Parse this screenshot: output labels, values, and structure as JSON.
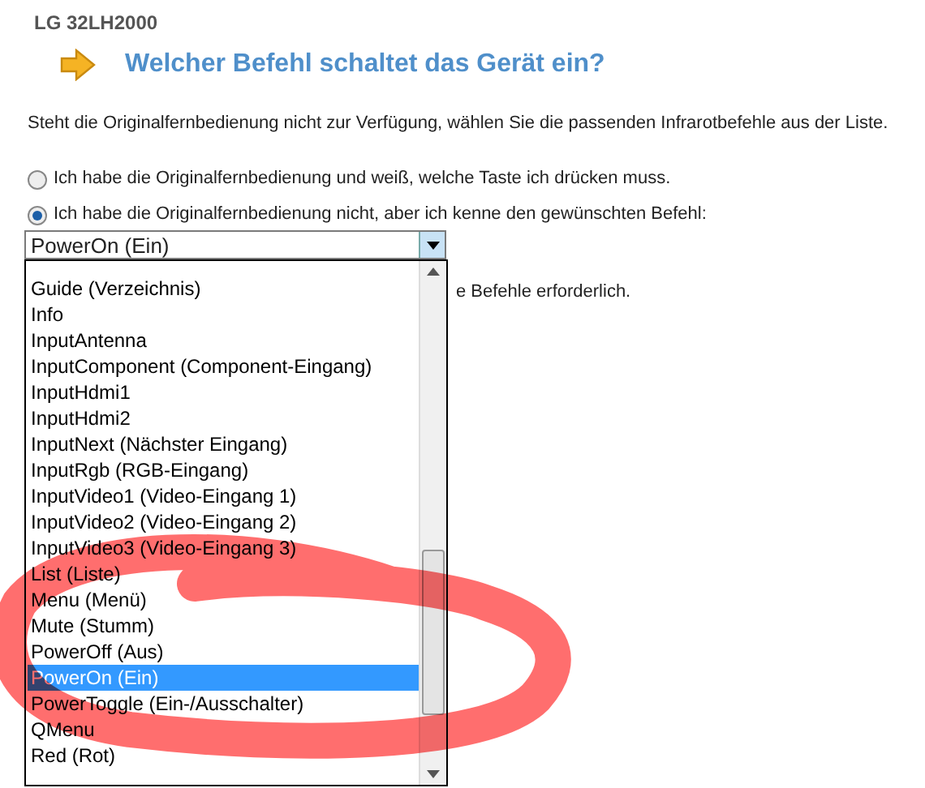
{
  "device_label": "LG 32LH2000",
  "heading": "Welcher Befehl schaltet das Gerät ein?",
  "instruction": "Steht die Originalfernbedienung nicht zur Verfügung, wählen Sie die passenden Infrarotbefehle aus der Liste.",
  "radios": [
    {
      "label": "Ich habe die Originalfernbedienung und weiß, welche Taste ich drücken muss.",
      "selected": false
    },
    {
      "label": "Ich habe die Originalfernbedienung nicht, aber ich kenne den gewünschten Befehl:",
      "selected": true
    }
  ],
  "select": {
    "value": "PowerOn (Ein)"
  },
  "note_behind_list": "e Befehle erforderlich.",
  "dropdown": {
    "items": [
      {
        "label": "Guide (Verzeichnis)",
        "selected": false
      },
      {
        "label": "Info",
        "selected": false
      },
      {
        "label": "InputAntenna",
        "selected": false
      },
      {
        "label": "InputComponent (Component-Eingang)",
        "selected": false
      },
      {
        "label": "InputHdmi1",
        "selected": false
      },
      {
        "label": "InputHdmi2",
        "selected": false
      },
      {
        "label": "InputNext (Nächster Eingang)",
        "selected": false
      },
      {
        "label": "InputRgb (RGB-Eingang)",
        "selected": false
      },
      {
        "label": "InputVideo1 (Video-Eingang 1)",
        "selected": false
      },
      {
        "label": "InputVideo2 (Video-Eingang 2)",
        "selected": false
      },
      {
        "label": "InputVideo3 (Video-Eingang 3)",
        "selected": false
      },
      {
        "label": "List (Liste)",
        "selected": false
      },
      {
        "label": "Menu (Menü)",
        "selected": false
      },
      {
        "label": "Mute (Stumm)",
        "selected": false
      },
      {
        "label": "PowerOff (Aus)",
        "selected": false
      },
      {
        "label": "PowerOn (Ein)",
        "selected": true
      },
      {
        "label": "PowerToggle (Ein-/Ausschalter)",
        "selected": false
      },
      {
        "label": "QMenu",
        "selected": false
      },
      {
        "label": "Red (Rot)",
        "selected": false
      }
    ]
  }
}
